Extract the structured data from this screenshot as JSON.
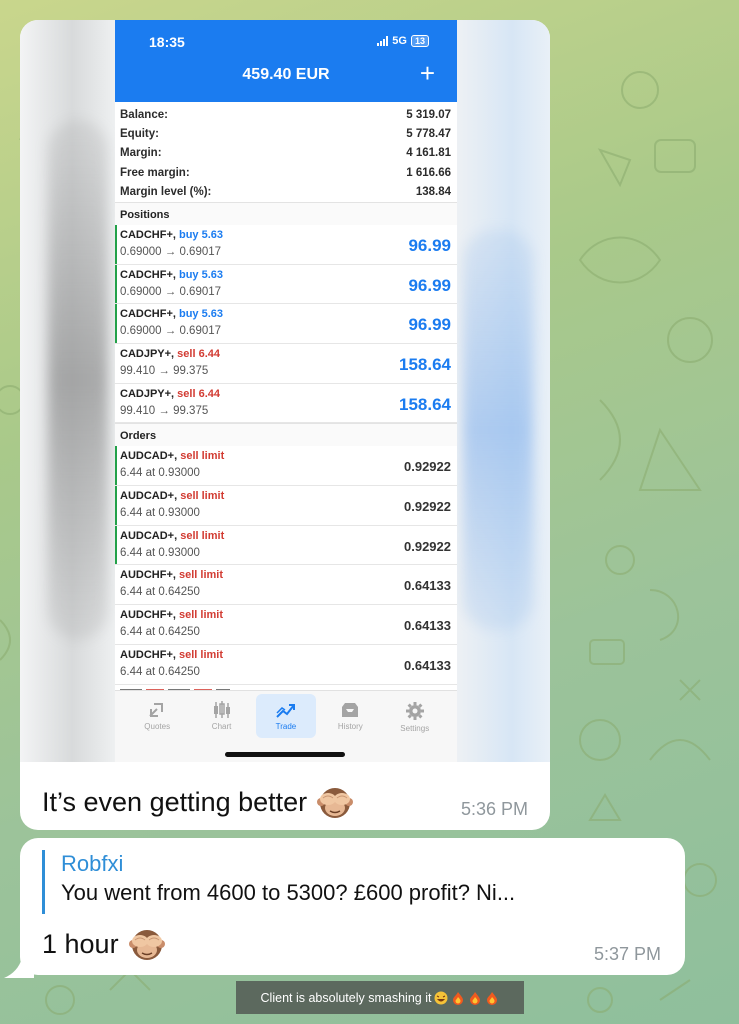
{
  "phone": {
    "status_time": "18:35",
    "network": "5G",
    "battery": "13",
    "account_title": "459.40 EUR",
    "add_label": "+"
  },
  "metrics": [
    {
      "label": "Balance:",
      "value": "5 319.07"
    },
    {
      "label": "Equity:",
      "value": "5 778.47"
    },
    {
      "label": "Margin:",
      "value": "4 161.81"
    },
    {
      "label": "Free margin:",
      "value": "1 616.66"
    },
    {
      "label": "Margin level (%):",
      "value": "138.84"
    }
  ],
  "positions_title": "Positions",
  "positions": [
    {
      "symbol": "CADCHF+,",
      "side": "buy 5.63",
      "route": "0.69000 → 0.69017",
      "profit": "96.99"
    },
    {
      "symbol": "CADCHF+,",
      "side": "buy 5.63",
      "route": "0.69000 → 0.69017",
      "profit": "96.99"
    },
    {
      "symbol": "CADCHF+,",
      "side": "buy 5.63",
      "route": "0.69000 → 0.69017",
      "profit": "96.99"
    },
    {
      "symbol": "CADJPY+,",
      "side": "sell 6.44",
      "route": "99.410 → 99.375",
      "profit": "158.64"
    },
    {
      "symbol": "CADJPY+,",
      "side": "sell 6.44",
      "route": "99.410 → 99.375",
      "profit": "158.64"
    }
  ],
  "orders_title": "Orders",
  "orders": [
    {
      "symbol": "AUDCAD+,",
      "side": "sell limit",
      "detail": "6.44 at 0.93000",
      "price": "0.92922"
    },
    {
      "symbol": "AUDCAD+,",
      "side": "sell limit",
      "detail": "6.44 at 0.93000",
      "price": "0.92922"
    },
    {
      "symbol": "AUDCAD+,",
      "side": "sell limit",
      "detail": "6.44 at 0.93000",
      "price": "0.92922"
    },
    {
      "symbol": "AUDCHF+,",
      "side": "sell limit",
      "detail": "6.44 at 0.64250",
      "price": "0.64133"
    },
    {
      "symbol": "AUDCHF+,",
      "side": "sell limit",
      "detail": "6.44 at 0.64250",
      "price": "0.64133"
    },
    {
      "symbol": "AUDCHF+,",
      "side": "sell limit",
      "detail": "6.44 at 0.64250",
      "price": "0.64133"
    }
  ],
  "tabs": [
    {
      "label": "Quotes",
      "icon": "quotes-icon"
    },
    {
      "label": "Chart",
      "icon": "chart-icon"
    },
    {
      "label": "Trade",
      "icon": "trade-icon",
      "active": true
    },
    {
      "label": "History",
      "icon": "history-icon"
    },
    {
      "label": "Settings",
      "icon": "settings-icon"
    }
  ],
  "message1": {
    "text": "It’s even getting better",
    "emoji": "see-no-evil-monkey",
    "time": "5:36 PM"
  },
  "message2": {
    "reply_author": "Robfxi",
    "reply_text": "You went from 4600 to 5300? £600 profit? Ni...",
    "text": "1 hour",
    "emoji": "see-no-evil-monkey",
    "time": "5:37 PM"
  },
  "caption": {
    "text": "Client is absolutely smashing it",
    "emojis": [
      "laughing-face",
      "fire",
      "fire",
      "fire"
    ]
  },
  "colors": {
    "accent": "#1b7cf0",
    "sell": "#d23b32",
    "link": "#2f8ed7",
    "position_marker": "#23a149"
  }
}
